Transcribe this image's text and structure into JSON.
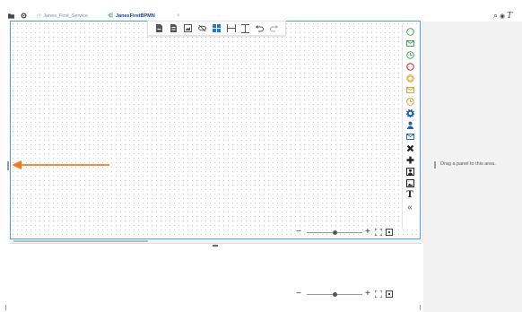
{
  "tabbar": {
    "icons": [
      "folder-icon",
      "gear-icon"
    ],
    "tabs": [
      {
        "label": "Janes_First_Service",
        "icon": "service-icon",
        "active": false
      },
      {
        "label": "JanesFirstBPMN",
        "icon": "bpmn-icon",
        "active": true
      }
    ],
    "close_glyph": "×"
  },
  "top_right_tools": {
    "search": "⌕",
    "view": "◉",
    "text": "T"
  },
  "canvas_toolbar": {
    "buttons": [
      "page-icon",
      "page-alt-icon",
      "export-image-icon",
      "hide-icon",
      "grid-layout-icon",
      "horizontal-spacing-icon",
      "vertical-spacing-icon",
      "undo-icon",
      "redo-icon"
    ]
  },
  "palette": {
    "items": [
      {
        "name": "start-event-icon",
        "color": "#2e9e4a"
      },
      {
        "name": "message-start-event-icon",
        "color": "#2e9e4a"
      },
      {
        "name": "timer-start-event-icon",
        "color": "#2e9e4a"
      },
      {
        "name": "end-event-icon",
        "color": "#d4263a"
      },
      {
        "name": "intermediate-event-icon",
        "color": "#e39a1c"
      },
      {
        "name": "message-intermediate-event-icon",
        "color": "#e39a1c"
      },
      {
        "name": "timer-intermediate-event-icon",
        "color": "#e39a1c"
      },
      {
        "name": "service-task-icon",
        "color": "#1f5fb0"
      },
      {
        "name": "user-task-icon",
        "color": "#1f5fb0"
      },
      {
        "name": "message-task-icon",
        "color": "#1f5fb0"
      },
      {
        "name": "exclusive-gateway-icon",
        "color": "#222222"
      },
      {
        "name": "parallel-gateway-icon",
        "color": "#222222"
      },
      {
        "name": "subprocess-icon",
        "color": "#222222"
      },
      {
        "name": "image-icon",
        "color": "#222222"
      },
      {
        "name": "text-annotation-icon",
        "color": "#222222"
      },
      {
        "name": "collapse-icon",
        "color": "#555555"
      }
    ],
    "text_glyph": "T",
    "collapse_glyph": "«"
  },
  "zoom": {
    "canvas_level": 0.5,
    "preview_level": 0.5,
    "minus": "−",
    "plus": "+"
  },
  "right_panel": {
    "placeholder": "Drag a panel to this area."
  },
  "colors": {
    "canvas_border": "#4aa3d4",
    "arrow": "#f07c1d",
    "right_panel_bg": "#f2f2f2"
  }
}
